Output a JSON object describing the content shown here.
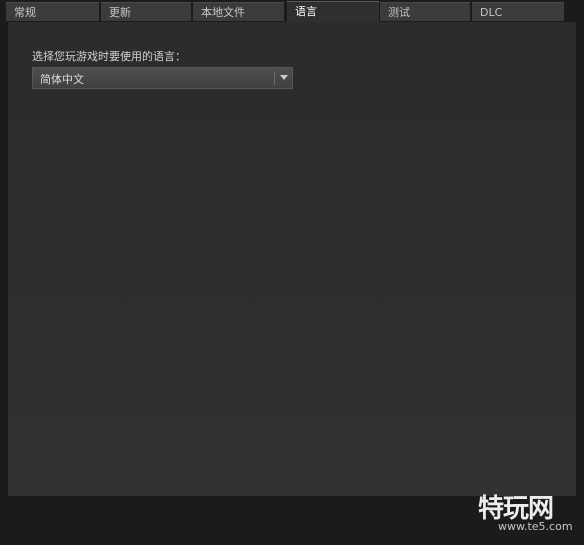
{
  "tabs": [
    {
      "label": "常规",
      "active": false
    },
    {
      "label": "更新",
      "active": false
    },
    {
      "label": "本地文件",
      "active": false
    },
    {
      "label": "语言",
      "active": true
    },
    {
      "label": "测试",
      "active": false
    },
    {
      "label": "DLC",
      "active": false
    }
  ],
  "language": {
    "prompt": "选择您玩游戏时要使用的语言：",
    "selected": "简体中文"
  },
  "watermark": {
    "brand": "特玩网",
    "url": "www.te5.com"
  },
  "icons": {
    "dropdown_arrow": "chevron-down-icon"
  }
}
